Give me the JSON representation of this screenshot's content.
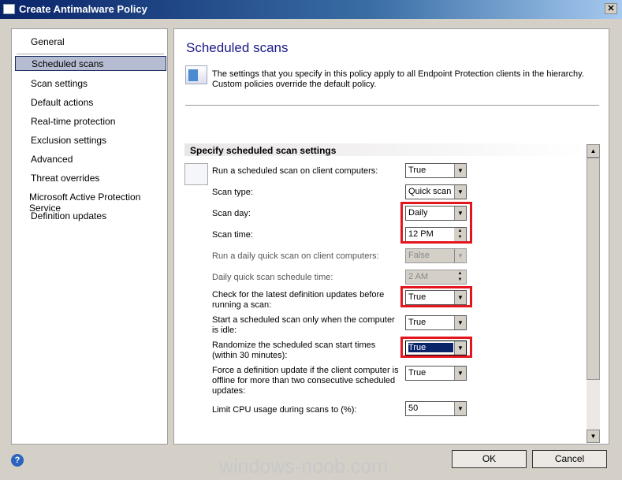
{
  "window": {
    "title": "Create Antimalware Policy",
    "close": "✕"
  },
  "nav": {
    "items": [
      "General",
      "Scheduled scans",
      "Scan settings",
      "Default actions",
      "Real-time protection",
      "Exclusion settings",
      "Advanced",
      "Threat overrides",
      "Microsoft Active Protection Service",
      "Definition updates"
    ],
    "selected": "Scheduled scans"
  },
  "main": {
    "title": "Scheduled scans",
    "description": "The settings that you specify in this policy apply to all Endpoint Protection clients in the hierarchy. Custom policies override the default policy.",
    "section": "Specify scheduled scan settings",
    "settings": [
      {
        "label": "Run a scheduled scan on client computers:",
        "value": "True"
      },
      {
        "label": "Scan type:",
        "value": "Quick scan"
      },
      {
        "label": "Scan day:",
        "value": "Daily"
      },
      {
        "label": "Scan time:",
        "value": "12 PM"
      },
      {
        "label": "Run a daily quick scan on client computers:",
        "value": "False"
      },
      {
        "label": "Daily quick scan schedule time:",
        "value": "2 AM"
      },
      {
        "label": "Check for the latest definition updates before running a scan:",
        "value": "True"
      },
      {
        "label": "Start a scheduled scan only when the computer is idle:",
        "value": "True"
      },
      {
        "label": "Randomize the scheduled scan start times (within 30 minutes):",
        "value": "True"
      },
      {
        "label": "Force a definition update if the client computer is offline for more than two consecutive scheduled updates:",
        "value": "True"
      },
      {
        "label": "Limit CPU usage during scans to (%):",
        "value": "50"
      }
    ]
  },
  "buttons": {
    "ok": "OK",
    "cancel": "Cancel",
    "help": "?"
  },
  "watermark": "windows-noob.com",
  "highlight_color": "#e3151d"
}
